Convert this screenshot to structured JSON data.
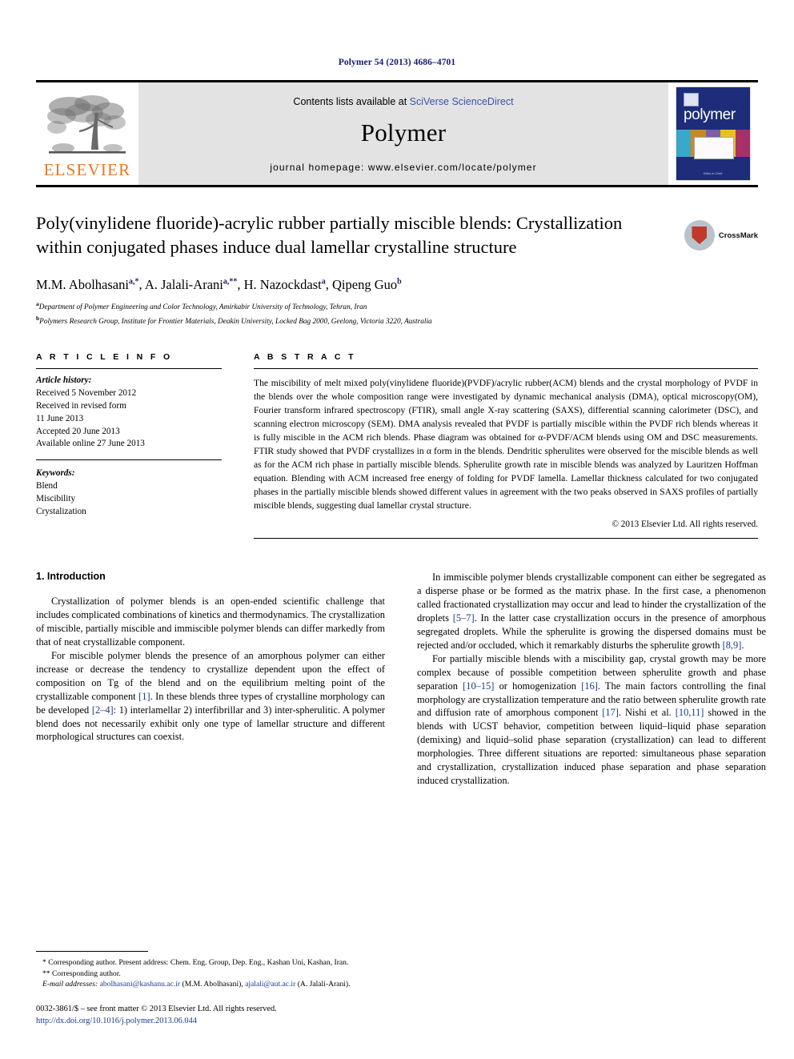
{
  "running_head": "Polymer 54 (2013) 4686–4701",
  "masthead": {
    "elsevier_wordmark": "ELSEVIER",
    "contents_prefix": "Contents lists available at ",
    "contents_link": "SciVerse ScienceDirect",
    "journal_name": "Polymer",
    "homepage": "journal homepage: www.elsevier.com/locate/polymer",
    "cover_title": "polymer",
    "cover_caption": "Editor-in-Chief:"
  },
  "article": {
    "title": "Poly(vinylidene fluoride)-acrylic rubber partially miscible blends: Crystallization within conjugated phases induce dual lamellar crystalline structure",
    "crossmark_label": "CrossMark",
    "authors": [
      {
        "name": "M.M. Abolhasani",
        "sup": "a,*"
      },
      {
        "name": "A. Jalali-Arani",
        "sup": "a,**"
      },
      {
        "name": "H. Nazockdast",
        "sup": "a"
      },
      {
        "name": "Qipeng Guo",
        "sup": "b"
      }
    ],
    "affiliations": [
      {
        "sup": "a",
        "text": "Department of Polymer Engineering and Color Technology, Amirkabir University of Technology, Tehran, Iran"
      },
      {
        "sup": "b",
        "text": "Polymers Research Group, Institute for Frontier Materials, Deakin University, Locked Bag 2000, Geelong, Victoria 3220, Australia"
      }
    ]
  },
  "article_info": {
    "heading": "A R T I C L E   I N F O",
    "history_label": "Article history:",
    "history": [
      "Received 5 November 2012",
      "Received in revised form",
      "11 June 2013",
      "Accepted 20 June 2013",
      "Available online 27 June 2013"
    ],
    "keywords_label": "Keywords:",
    "keywords": [
      "Blend",
      "Miscibility",
      "Crystalization"
    ]
  },
  "abstract": {
    "heading": "A B S T R A C T",
    "text": "The miscibility of melt mixed poly(vinylidene fluoride)(PVDF)/acrylic rubber(ACM) blends and the crystal morphology of PVDF in the blends over the whole composition range were investigated by dynamic mechanical analysis (DMA), optical microscopy(OM), Fourier transform infrared spectroscopy (FTIR), small angle X-ray scattering (SAXS), differential scanning calorimeter (DSC), and scanning electron microscopy (SEM). DMA analysis revealed that PVDF is partially miscible within the PVDF rich blends whereas it is fully miscible in the ACM rich blends. Phase diagram was obtained for α-PVDF/ACM blends using OM and DSC measurements. FTIR study showed that PVDF crystallizes in α form in the blends. Dendritic spherulites were observed for the miscible blends as well as for the ACM rich phase in partially miscible blends. Spherulite growth rate in miscible blends was analyzed by Lauritzen Hoffman equation. Blending with ACM increased free energy of folding for PVDF lamella. Lamellar thickness calculated for two conjugated phases in the partially miscible blends showed different values in agreement with the two peaks observed in SAXS profiles of partially miscible blends, suggesting dual lamellar crystal structure.",
    "copyright": "© 2013 Elsevier Ltd. All rights reserved."
  },
  "introduction": {
    "heading": "1. Introduction",
    "left_paragraphs": [
      "Crystallization of polymer blends is an open-ended scientific challenge that includes complicated combinations of kinetics and thermodynamics. The crystallization of miscible, partially miscible and immiscible polymer blends can differ markedly from that of neat crystallizable component.",
      "For miscible polymer blends the presence of an amorphous polymer can either increase or decrease the tendency to crystallize dependent upon the effect of composition on Tg of the blend and on the equilibrium melting point of the crystallizable component [1]. In these blends three types of crystalline morphology can be developed [2–4]: 1) interlamellar 2) interfibrillar and 3) inter-spherulitic. A polymer blend does not necessarily exhibit only one type of lamellar structure and different morphological structures can coexist."
    ],
    "right_paragraphs": [
      "In immiscible polymer blends crystallizable component can either be segregated as a disperse phase or be formed as the matrix phase. In the first case, a phenomenon called fractionated crystallization may occur and lead to hinder the crystallization of the droplets [5–7]. In the latter case crystallization occurs in the presence of amorphous segregated droplets. While the spherulite is growing the dispersed domains must be rejected and/or occluded, which it remarkably disturbs the spherulite growth [8,9].",
      "For partially miscible blends with a miscibility gap, crystal growth may be more complex because of possible competition between spherulite growth and phase separation [10–15] or homogenization [16]. The main factors controlling the final morphology are crystallization temperature and the ratio between spherulite growth rate and diffusion rate of amorphous component [17]. Nishi et al. [10,11] showed in the blends with UCST behavior, competition between liquid–liquid phase separation (demixing) and liquid–solid phase separation (crystallization) can lead to different morphologies. Three different situations are reported: simultaneous phase separation and crystallization, crystallization induced phase separation and phase separation induced crystallization."
    ]
  },
  "footnotes": {
    "corresponding_1": "* Corresponding author. Present address: Chem. Eng. Group, Dep. Eng., Kashan Uni, Kashan, Iran.",
    "corresponding_2": "** Corresponding author.",
    "email_label": "E-mail addresses:",
    "email_1": "abolhasani@kashanu.ac.ir",
    "email_1_owner": "(M.M. Abolhasani),",
    "email_2": "ajalali@aut.ac.ir",
    "email_2_owner": "(A. Jalali-Arani).",
    "issn_line": "0032-3861/$ – see front matter © 2013 Elsevier Ltd. All rights reserved.",
    "doi": "http://dx.doi.org/10.1016/j.polymer.2013.06.044"
  },
  "colors": {
    "elsevier_orange": "#E87722",
    "link_blue": "#1a3a8f",
    "running_head_blue": "#1a1a6e",
    "cover_blue": "#1d2d7a"
  }
}
